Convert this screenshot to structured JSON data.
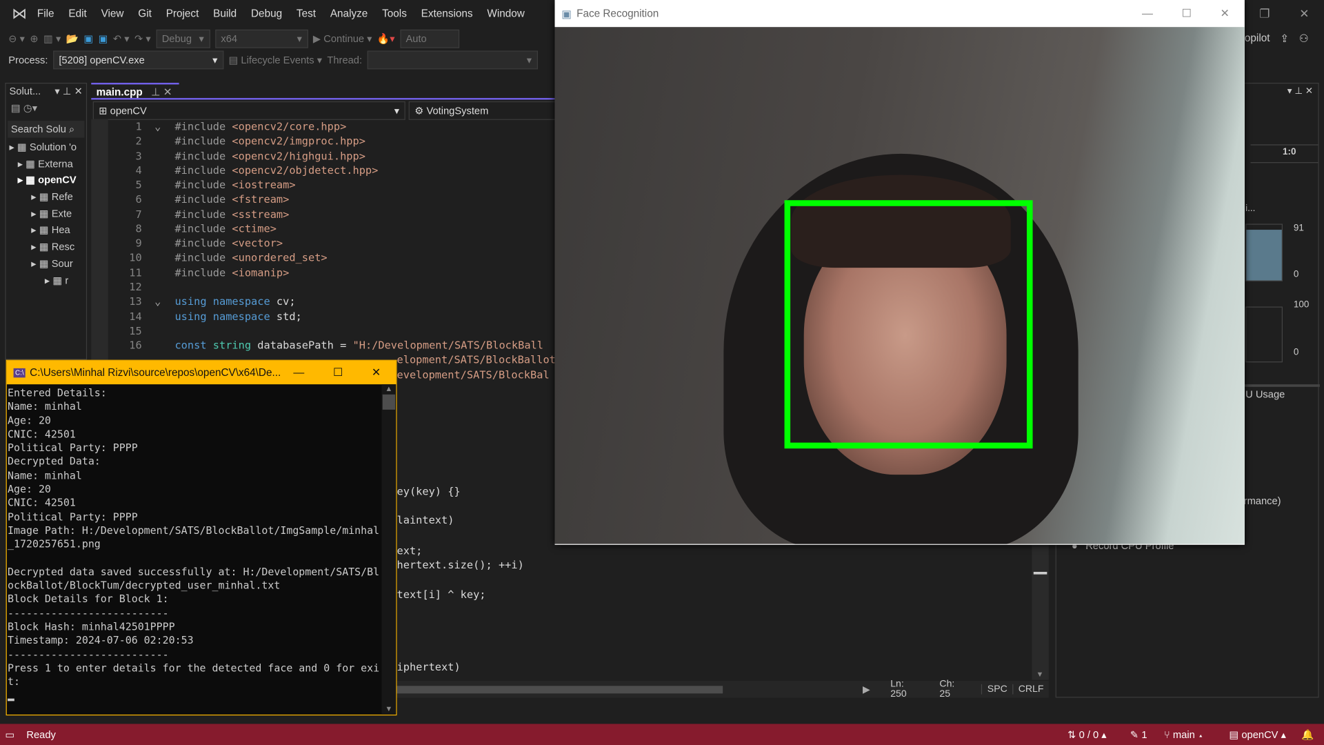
{
  "menu": {
    "items": [
      "File",
      "Edit",
      "View",
      "Git",
      "Project",
      "Build",
      "Debug",
      "Test",
      "Analyze",
      "Tools",
      "Extensions",
      "Window"
    ]
  },
  "toolbar": {
    "config": "Debug",
    "platform": "x64",
    "continue": "Continue",
    "auto": "Auto",
    "copilot": "opilot"
  },
  "process_bar": {
    "process_label": "Process:",
    "process_value": "[5208] openCV.exe",
    "lifecycle": "Lifecycle Events",
    "thread_label": "Thread:"
  },
  "solution_explorer": {
    "title": "Solut...",
    "search_placeholder": "Search Solu",
    "items": [
      "Solution 'o",
      "Externa",
      "openCV",
      "Refe",
      "Exte",
      "Hea",
      "Resc",
      "Sour",
      "r"
    ]
  },
  "editor": {
    "tab": "main.cpp",
    "nav_project": "openCV",
    "nav_scope": "VotingSystem",
    "lines": [
      [
        {
          "c": "pp",
          "t": "#include "
        },
        {
          "c": "st",
          "t": "<opencv2/core.hpp>"
        }
      ],
      [
        {
          "c": "pp",
          "t": "#include "
        },
        {
          "c": "st",
          "t": "<opencv2/imgproc.hpp>"
        }
      ],
      [
        {
          "c": "pp",
          "t": "#include "
        },
        {
          "c": "st",
          "t": "<opencv2/highgui.hpp>"
        }
      ],
      [
        {
          "c": "pp",
          "t": "#include "
        },
        {
          "c": "st",
          "t": "<opencv2/objdetect.hpp>"
        }
      ],
      [
        {
          "c": "pp",
          "t": "#include "
        },
        {
          "c": "st",
          "t": "<iostream>"
        }
      ],
      [
        {
          "c": "pp",
          "t": "#include "
        },
        {
          "c": "st",
          "t": "<fstream>"
        }
      ],
      [
        {
          "c": "pp",
          "t": "#include "
        },
        {
          "c": "st",
          "t": "<sstream>"
        }
      ],
      [
        {
          "c": "pp",
          "t": "#include "
        },
        {
          "c": "st",
          "t": "<ctime>"
        }
      ],
      [
        {
          "c": "pp",
          "t": "#include "
        },
        {
          "c": "st",
          "t": "<vector>"
        }
      ],
      [
        {
          "c": "pp",
          "t": "#include "
        },
        {
          "c": "st",
          "t": "<unordered_set>"
        }
      ],
      [
        {
          "c": "pp",
          "t": "#include "
        },
        {
          "c": "st",
          "t": "<iomanip>"
        }
      ],
      [],
      [
        {
          "c": "kw",
          "t": "using namespace "
        },
        {
          "c": "id",
          "t": "cv;"
        }
      ],
      [
        {
          "c": "kw",
          "t": "using namespace "
        },
        {
          "c": "id",
          "t": "std;"
        }
      ],
      [],
      [
        {
          "c": "kw",
          "t": "const "
        },
        {
          "c": "ty",
          "t": "string "
        },
        {
          "c": "id",
          "t": "databasePath = "
        },
        {
          "c": "st",
          "t": "\"H:/Development/SATS/BlockBall"
        }
      ]
    ],
    "partial_lines": [
      {
        "row": 17,
        "t": "elopment/SATS/BlockBallot"
      },
      {
        "row": 18,
        "t": "evelopment/SATS/BlockBal"
      }
    ],
    "visible_fragments": [
      "ey(key) {}",
      "laintext)",
      "ext;",
      "hertext.size(); ++i)",
      "text[i] ^ key;",
      "iphertext)"
    ],
    "status": {
      "line": "Ln: 250",
      "col": "Ch: 25",
      "spacing": "SPC",
      "eol": "CRLF"
    }
  },
  "face_window": {
    "title": "Face Recognition",
    "box_color": "#00ff00"
  },
  "console": {
    "title": "C:\\Users\\Minhal Rizvi\\source\\repos\\openCV\\x64\\De...",
    "lines": [
      "Entered Details:",
      "Name: minhal",
      "Age: 20",
      "CNIC: 42501",
      "Political Party: PPPP",
      "Decrypted Data:",
      "Name: minhal",
      "Age: 20",
      "CNIC: 42501",
      "Political Party: PPPP",
      "Image Path: H:/Development/SATS/BlockBallot/ImgSample/minhal",
      "_1720257651.png",
      "",
      "Decrypted data saved successfully at: H:/Development/SATS/Bl",
      "ockBallot/BlockTum/decrypted_user_minhal.txt",
      "Block Details for Block 1:",
      "--------------------------",
      "Block Hash: minhal42501PPPP",
      "Timestamp: 2024-07-06 02:20:53",
      "--------------------------",
      "Press 1 to enter details for the detected face and 0 for exi",
      "t:"
    ]
  },
  "diagnostics": {
    "time": "1:0",
    "label1": "i...",
    "mem_max": "91",
    "mem_min": "0",
    "cpu_max": "100",
    "cpu_min": "0",
    "tab": "U Usage",
    "perf": "rmance)",
    "record": "Record CPU Profile"
  },
  "statusbar": {
    "ready": "Ready",
    "changes": "0 / 0",
    "edits": "1",
    "branch": "main",
    "repo": "openCV",
    "color": "#861b2d"
  }
}
